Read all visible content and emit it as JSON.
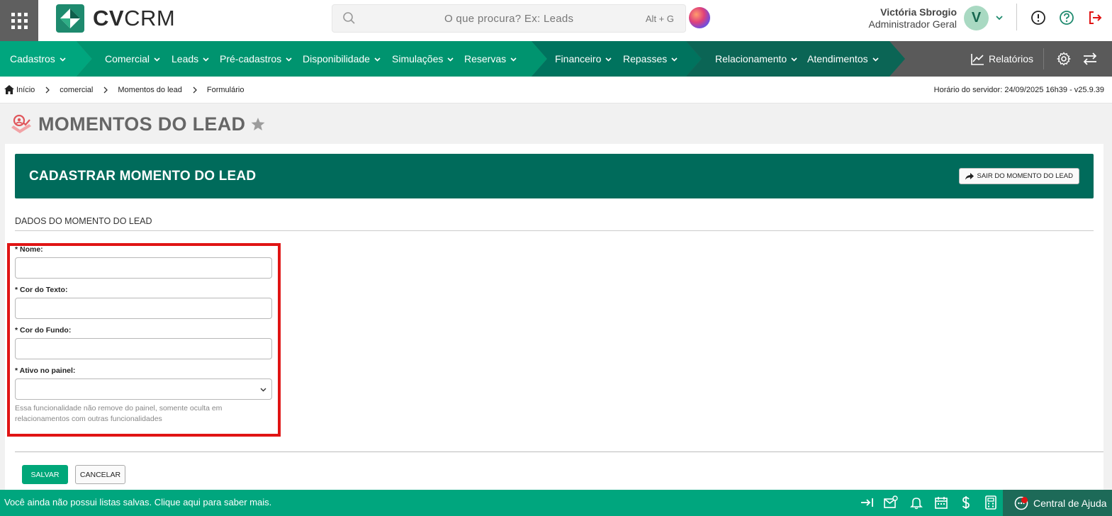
{
  "brand": {
    "logo_strong": "CV",
    "logo_light": "CRM"
  },
  "search": {
    "placeholder": "O que procura? Ex: Leads",
    "shortcut": "Alt + G"
  },
  "user": {
    "name": "Victória Sbrogio",
    "role": "Administrador Geral",
    "initial": "V"
  },
  "nav": {
    "items": [
      {
        "label": "Cadastros"
      },
      {
        "label": "Comercial"
      },
      {
        "label": "Leads"
      },
      {
        "label": "Pré-cadastros"
      },
      {
        "label": "Disponibilidade"
      },
      {
        "label": "Simulações"
      },
      {
        "label": "Reservas"
      },
      {
        "label": "Financeiro"
      },
      {
        "label": "Repasses"
      },
      {
        "label": "Relacionamento"
      },
      {
        "label": "Atendimentos"
      }
    ],
    "reports_label": "Relatórios"
  },
  "breadcrumb": [
    "Início",
    "comercial",
    "Momentos do lead",
    "Formulário"
  ],
  "server_time": "Horário do servidor: 24/09/2025 16h39 - v25.9.39",
  "page": {
    "title": "MOMENTOS DO LEAD"
  },
  "form": {
    "header": "CADASTRAR MOMENTO DO LEAD",
    "exit_label": "SAIR DO MOMENTO DO LEAD",
    "section": "DADOS DO MOMENTO DO LEAD",
    "fields": [
      {
        "label": "* Nome:",
        "value": ""
      },
      {
        "label": "* Cor do Texto:",
        "value": ""
      },
      {
        "label": "* Cor do Fundo:",
        "value": ""
      },
      {
        "label": "* Ativo no painel:",
        "value": ""
      }
    ],
    "hint": "Essa funcionalidade não remove do painel, somente oculta em relacionamentos com outras funcionalidades",
    "save_label": "SALVAR",
    "cancel_label": "CANCELAR"
  },
  "footer": {
    "message": "Você ainda não possui listas salvas. Clique aqui para saber mais.",
    "help_label": "Central de Ajuda"
  },
  "colors": {
    "primary_dark": "#006b5b",
    "accent": "#00a67e",
    "nav_gray": "#5a5a5a",
    "danger": "#e01414"
  }
}
